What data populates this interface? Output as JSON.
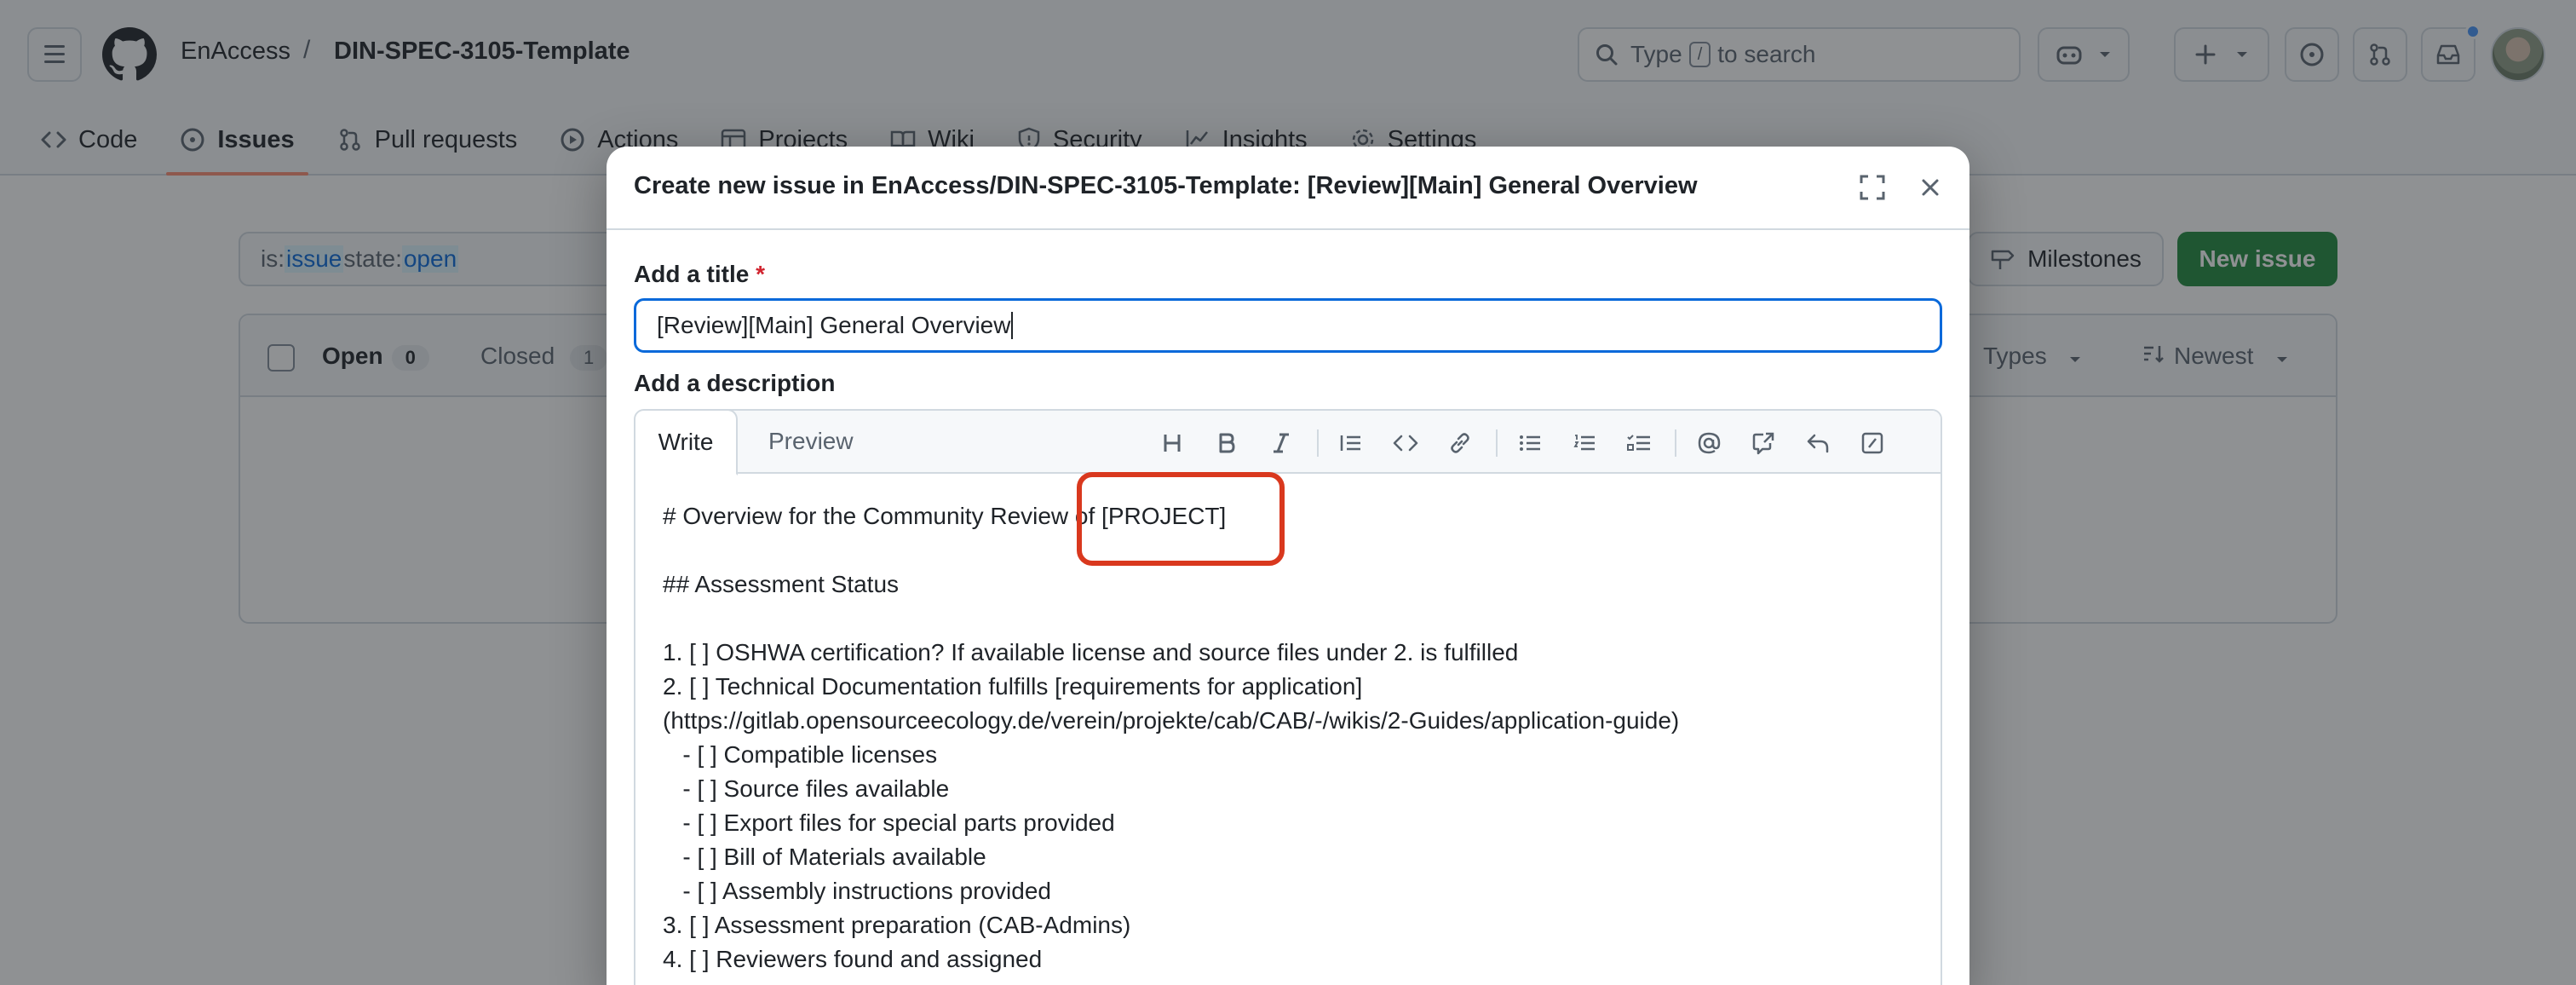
{
  "header": {
    "owner": "EnAccess",
    "separator": "/",
    "repo": "DIN-SPEC-3105-Template",
    "search_prefix": "Type",
    "search_key": "/",
    "search_suffix": "to search"
  },
  "repo_nav": {
    "tabs": [
      {
        "label": "Code",
        "icon": "code-icon"
      },
      {
        "label": "Issues",
        "icon": "issue-opened-icon"
      },
      {
        "label": "Pull requests",
        "icon": "git-pull-request-icon"
      },
      {
        "label": "Actions",
        "icon": "play-icon"
      },
      {
        "label": "Projects",
        "icon": "table-icon"
      },
      {
        "label": "Wiki",
        "icon": "book-icon"
      },
      {
        "label": "Security",
        "icon": "shield-icon"
      },
      {
        "label": "Insights",
        "icon": "graph-icon"
      },
      {
        "label": "Settings",
        "icon": "gear-icon"
      }
    ],
    "active": "Issues"
  },
  "issues_page": {
    "filter_parts": [
      "is:",
      "issue",
      " state:",
      "open"
    ],
    "milestones_label": "Milestones",
    "new_issue_label": "New issue",
    "open_label": "Open",
    "open_count": "0",
    "closed_label": "Closed",
    "closed_count": "1",
    "types_label": "Types",
    "sort_label": "Newest"
  },
  "dialog": {
    "title": "Create new issue in EnAccess/DIN-SPEC-3105-Template: [Review][Main] General Overview",
    "title_label": "Add a title",
    "required_mark": "*",
    "title_value": "[Review][Main] General Overview",
    "description_label": "Add a description",
    "tab_write": "Write",
    "tab_preview": "Preview",
    "body_lines": [
      "# Overview for the Community Review of [PROJECT]",
      "",
      "## Assessment Status",
      "",
      "1. [ ] OSHWA certification? If available license and source files under 2. is fulfilled",
      "2. [ ] Technical Documentation fulfills [requirements for application]",
      "(https://gitlab.opensourceecology.de/verein/projekte/cab/CAB/-/wikis/2-Guides/application-guide)",
      "   - [ ] Compatible licenses",
      "   - [ ] Source files available",
      "   - [ ] Export files for special parts provided",
      "   - [ ] Bill of Materials available",
      "   - [ ] Assembly instructions provided",
      "3. [ ] Assessment preparation (CAB-Admins)",
      "4. [ ] Reviewers found and assigned"
    ]
  },
  "colors": {
    "accent": "#0969da",
    "primary_button": "#1f883d",
    "active_tab_underline": "#fd8c73",
    "annotation": "#d9381e"
  }
}
